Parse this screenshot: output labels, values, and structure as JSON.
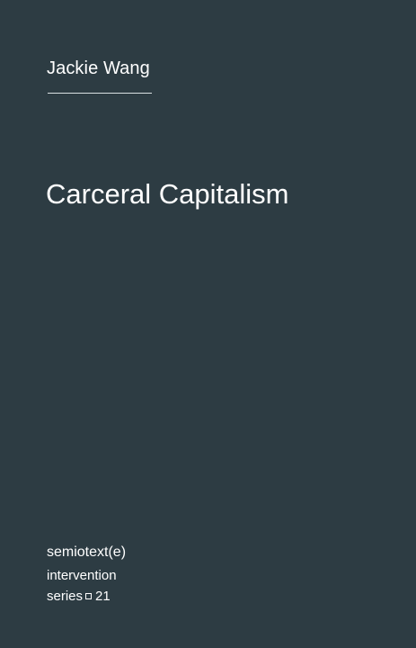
{
  "author": {
    "name": "Jackie Wang"
  },
  "book": {
    "title": "Carceral Capitalism"
  },
  "publisher": {
    "name": "semiotext(e)",
    "series_line_1": "intervention",
    "series_word": "series",
    "series_number": "21"
  },
  "colors": {
    "background": "#2d3c43",
    "text": "#ffffff",
    "rule": "#d9e0e2"
  },
  "icons": {
    "series_separator": "square-icon"
  }
}
